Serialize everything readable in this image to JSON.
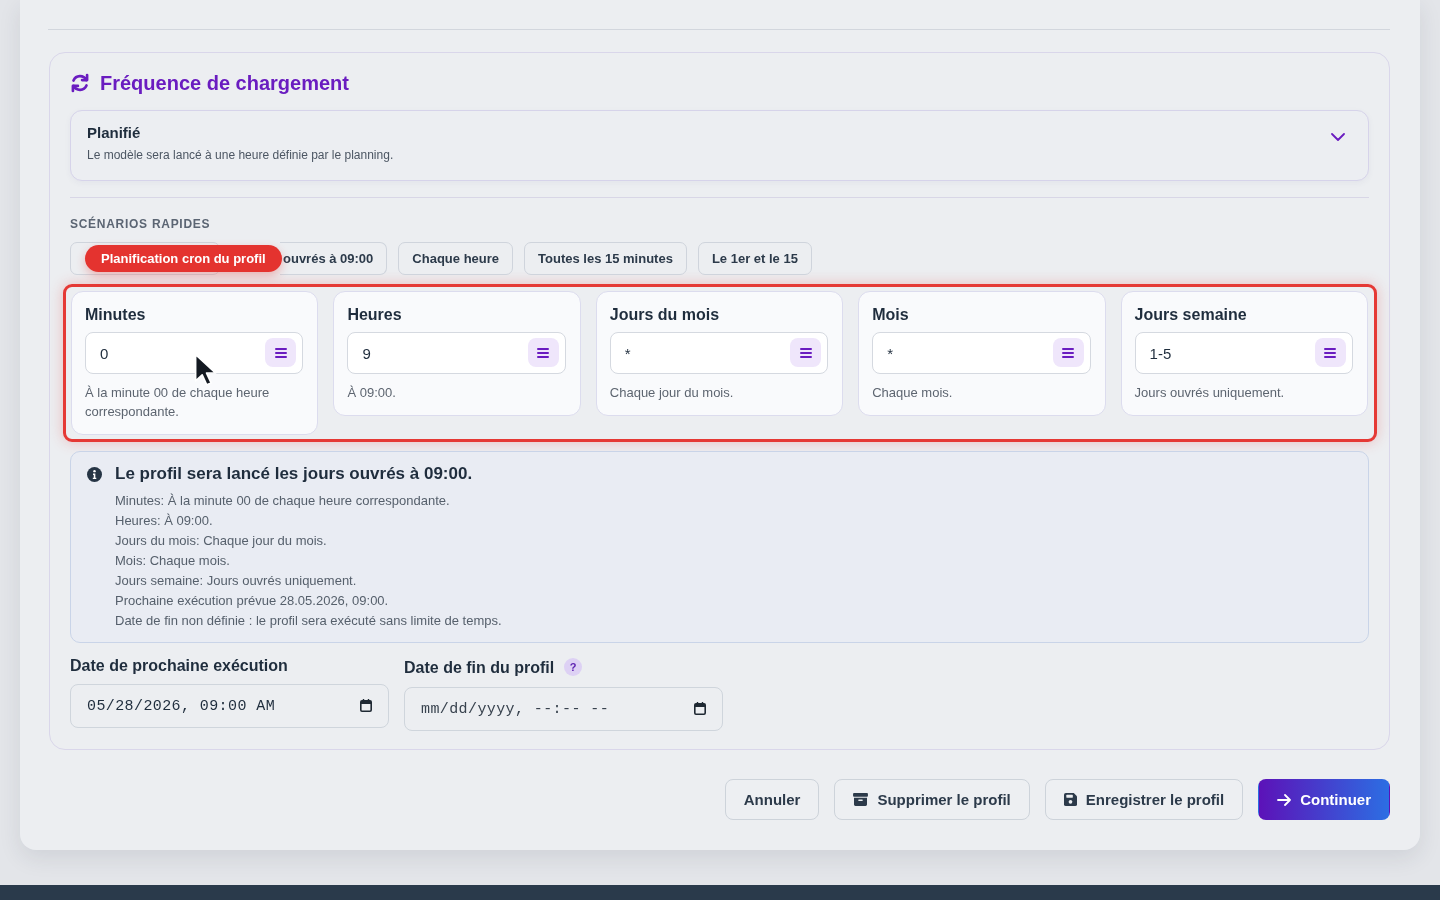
{
  "section": {
    "title": "Fréquence de chargement",
    "schedule_select": {
      "value": "Planifié",
      "description": "Le modèle sera lancé à une heure définie par le planning."
    },
    "quick_scenarios": {
      "heading": "SCÉNARIOS RAPIDES",
      "chips": [
        {
          "kind": "covered"
        },
        {
          "kind": "clipped",
          "label": "ouvrés à 09:00"
        },
        {
          "kind": "plain",
          "label": "Chaque heure"
        },
        {
          "kind": "plain",
          "label": "Toutes les 15 minutes"
        },
        {
          "kind": "plain",
          "label": "Le 1er et le 15"
        }
      ],
      "tooltip": "Planification cron du profil"
    },
    "cron_fields": [
      {
        "label": "Minutes",
        "value": "0",
        "description": "À la minute 00 de chaque heure correspondante."
      },
      {
        "label": "Heures",
        "value": "9",
        "description": "À 09:00."
      },
      {
        "label": "Jours du mois",
        "value": "*",
        "description": "Chaque jour du mois."
      },
      {
        "label": "Mois",
        "value": "*",
        "description": "Chaque mois."
      },
      {
        "label": "Jours semaine",
        "value": "1-5",
        "description": "Jours ouvrés uniquement."
      }
    ],
    "summary": {
      "title": "Le profil sera lancé les jours ouvrés à 09:00.",
      "lines": [
        "Minutes: À la minute 00 de chaque heure correspondante.",
        "Heures: À 09:00.",
        "Jours du mois: Chaque jour du mois.",
        "Mois: Chaque mois.",
        "Jours semaine: Jours ouvrés uniquement.",
        "Prochaine exécution prévue 28.05.2026, 09:00.",
        "Date de fin non définie : le profil sera exécuté sans limite de temps."
      ]
    },
    "date_fields": [
      {
        "label": "Date de prochaine exécution",
        "value": "05/28/2026, 09:00 AM"
      },
      {
        "label": "Date de fin du profil",
        "placeholder": "mm/dd/yyyy, --:-- --",
        "help": "?"
      }
    ]
  },
  "actions": [
    {
      "label": "Annuler",
      "kind": "cancel"
    },
    {
      "label": "Supprimer le profil",
      "kind": "delete"
    },
    {
      "label": "Enregistrer le profil",
      "kind": "save"
    },
    {
      "label": "Continuer",
      "kind": "primary"
    }
  ]
}
